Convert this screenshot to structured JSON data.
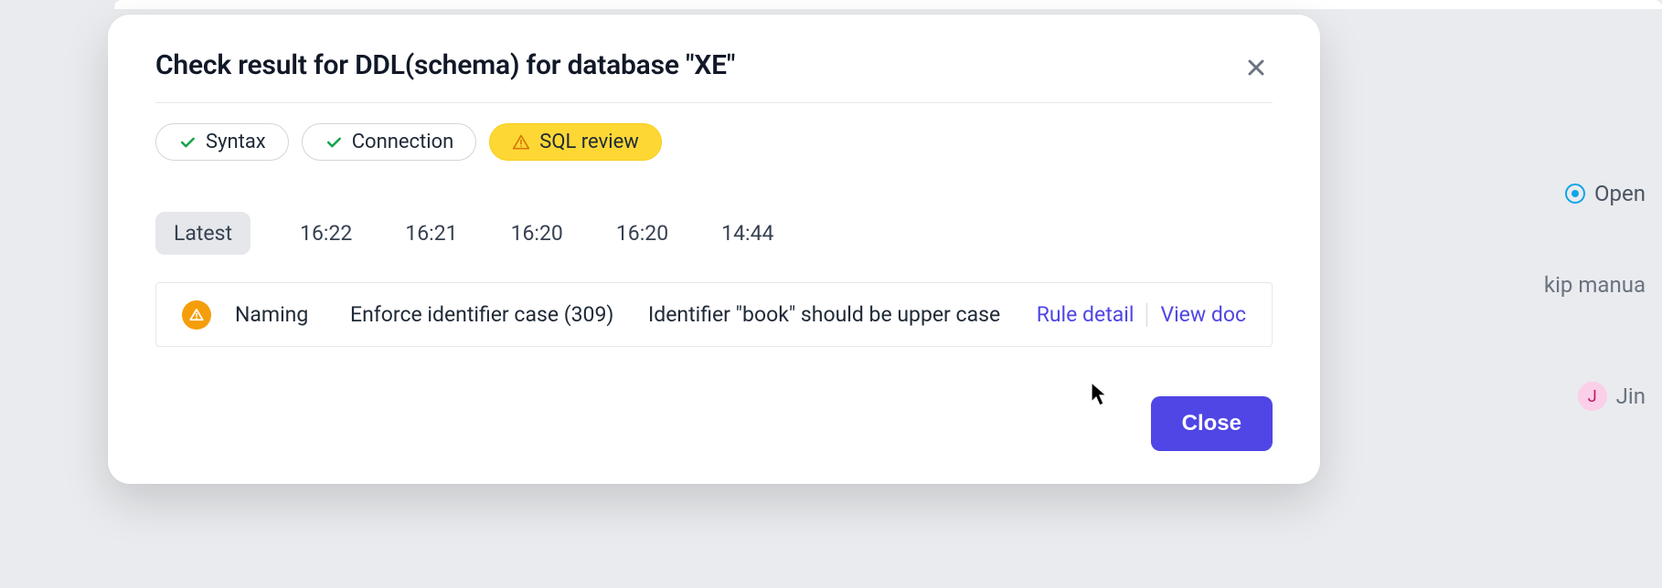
{
  "modal": {
    "title": "Check result for DDL(schema) for database \"XE\"",
    "close_button": "Close"
  },
  "chips": [
    {
      "label": "Syntax",
      "status": "ok"
    },
    {
      "label": "Connection",
      "status": "ok"
    },
    {
      "label": "SQL review",
      "status": "warn"
    }
  ],
  "times": {
    "selected": "Latest",
    "items": [
      "16:22",
      "16:21",
      "16:20",
      "16:20",
      "14:44"
    ]
  },
  "result": {
    "category": "Naming",
    "rule": "Enforce identifier case (309)",
    "message": "Identifier \"book\" should be upper case",
    "rule_detail_label": "Rule detail",
    "view_doc_label": "View doc"
  },
  "background": {
    "status": "Open",
    "skip": "kip manua",
    "user_initial": "J",
    "user_name": "Jin"
  }
}
